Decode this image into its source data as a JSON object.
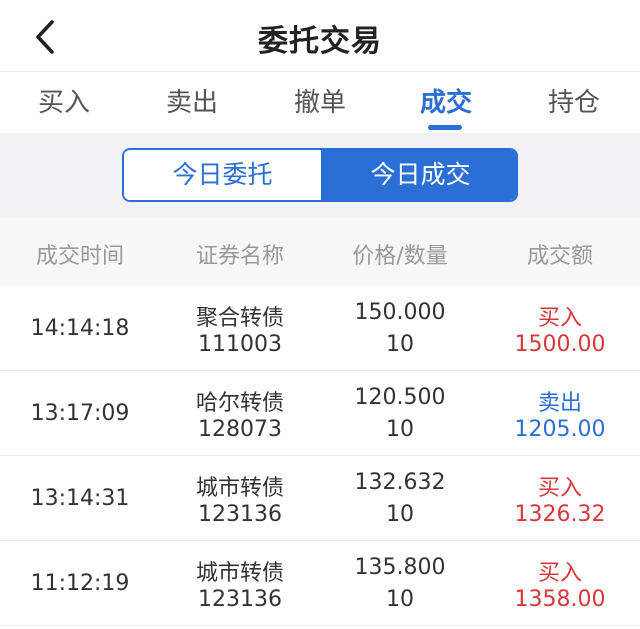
{
  "header": {
    "title": "委托交易"
  },
  "tabs": [
    "买入",
    "卖出",
    "撤单",
    "成交",
    "持仓"
  ],
  "segment": {
    "left": "今日委托",
    "right": "今日成交"
  },
  "columns": [
    "成交时间",
    "证券名称",
    "价格/数量",
    "成交额"
  ],
  "rows": [
    {
      "time": "14:14:18",
      "name": "聚合转债",
      "code": "111003",
      "price": "150.000",
      "qty": "10",
      "side": "买入",
      "amount": "1500.00",
      "side_type": "buy"
    },
    {
      "time": "13:17:09",
      "name": "哈尔转债",
      "code": "128073",
      "price": "120.500",
      "qty": "10",
      "side": "卖出",
      "amount": "1205.00",
      "side_type": "sell"
    },
    {
      "time": "13:14:31",
      "name": "城市转债",
      "code": "123136",
      "price": "132.632",
      "qty": "10",
      "side": "买入",
      "amount": "1326.32",
      "side_type": "buy"
    },
    {
      "time": "11:12:19",
      "name": "城市转债",
      "code": "123136",
      "price": "135.800",
      "qty": "10",
      "side": "买入",
      "amount": "1358.00",
      "side_type": "buy"
    }
  ],
  "colors": {
    "accent": "#2b6fd6",
    "buy": "#d8383b",
    "sell": "#2b6fd6"
  },
  "icons": {
    "back": "chevron-left-icon"
  }
}
